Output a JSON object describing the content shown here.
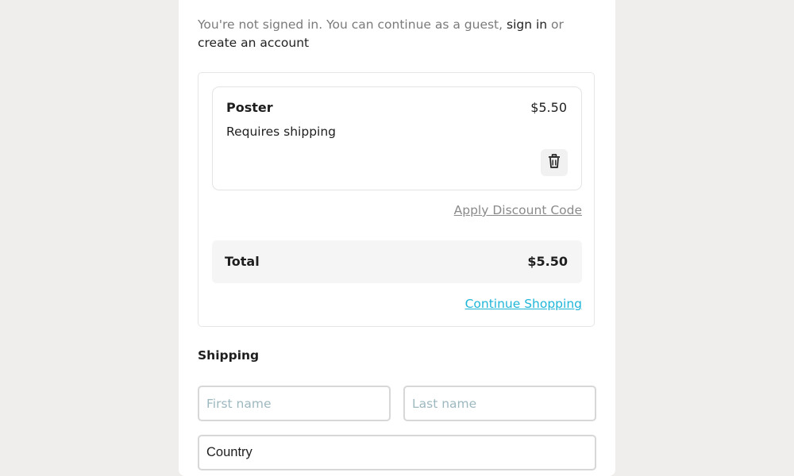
{
  "guest_notice": {
    "prefix": "You're not signed in. You can continue as a guest,",
    "sign_in": "sign in",
    "or": "or",
    "create_account": "create an account"
  },
  "cart": {
    "items": [
      {
        "name": "Poster",
        "price": "$5.50",
        "note": "Requires shipping"
      }
    ],
    "discount_link": "Apply Discount Code",
    "total_label": "Total",
    "total_value": "$5.50",
    "continue_link": "Continue Shopping"
  },
  "shipping": {
    "title": "Shipping",
    "first_name_placeholder": "First name",
    "last_name_placeholder": "Last name",
    "country_value": "Country"
  },
  "icons": {
    "delete": "trash-icon"
  },
  "colors": {
    "page_background": "#efeeec",
    "panel_background": "#ffffff",
    "link_accent": "#1fb6d8",
    "muted_text": "#7a7a7a"
  }
}
